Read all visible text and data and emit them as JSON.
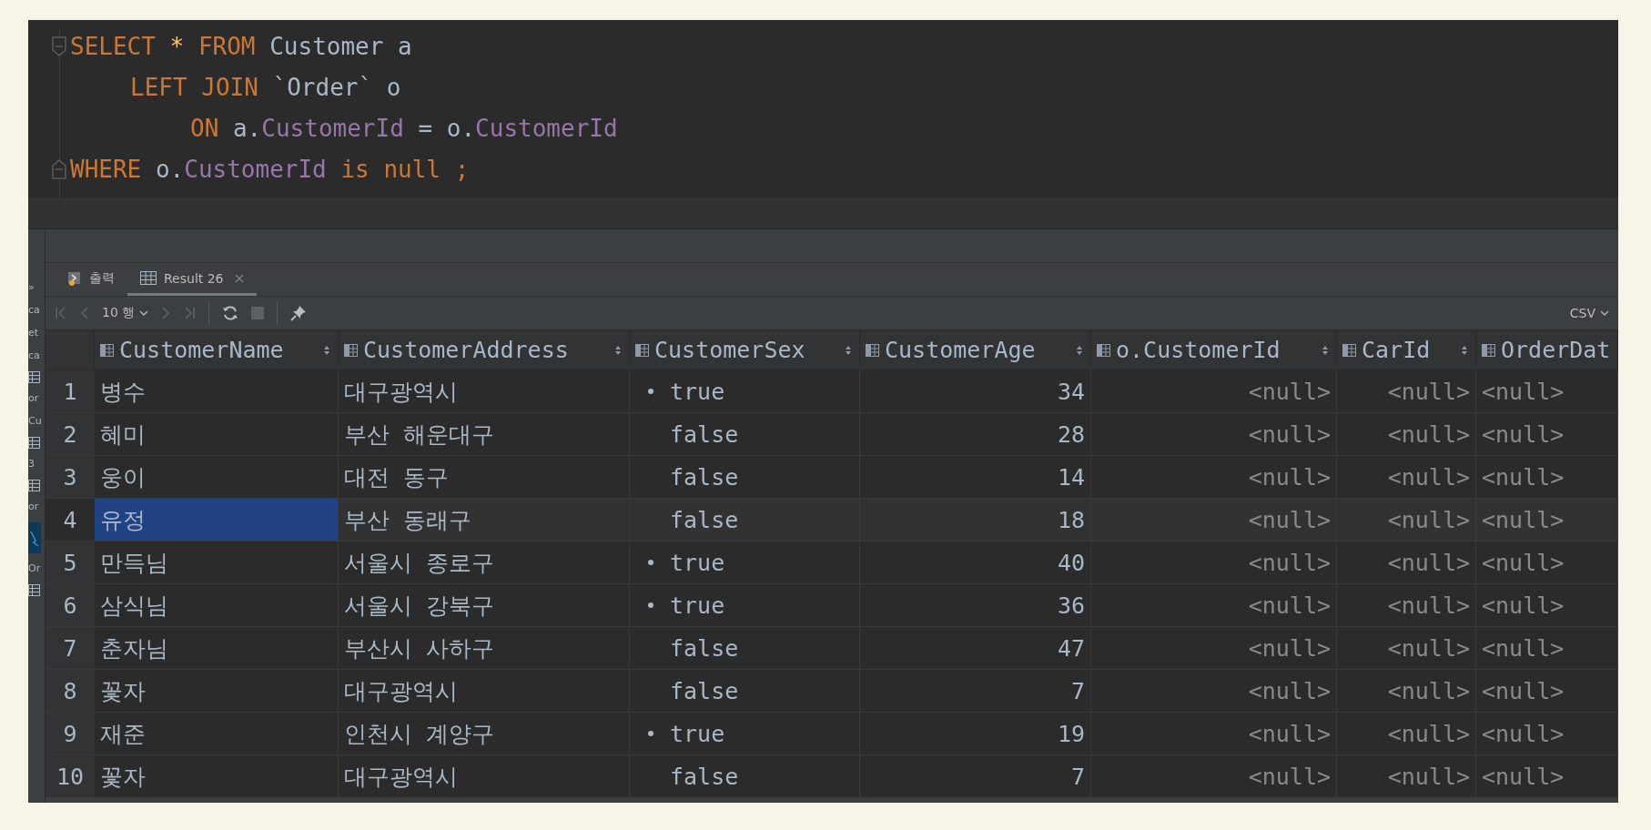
{
  "editor": {
    "lines": [
      {
        "kind": "top",
        "fold_open": true,
        "fold_close": false,
        "tokens": [
          {
            "kind": "keyword",
            "text": "SELECT"
          },
          {
            "kind": "star",
            "text": "*"
          },
          {
            "kind": "keyword",
            "text": "FROM"
          },
          {
            "kind": "plain",
            "text": "Customer a"
          }
        ]
      },
      {
        "kind": "sub",
        "fold_open": false,
        "fold_close": false,
        "tokens": [
          {
            "kind": "keyword",
            "text": "LEFT JOIN"
          },
          {
            "kind": "plain",
            "text": "`Order` o"
          }
        ]
      },
      {
        "kind": "subsub",
        "fold_open": false,
        "fold_close": false,
        "tokens": [
          {
            "kind": "keyword",
            "text": "ON"
          },
          {
            "kind": "plain",
            "text": "a."
          },
          {
            "kind": "field",
            "text": "CustomerId"
          },
          {
            "kind": "plain",
            "text": "="
          },
          {
            "kind": "plain",
            "text": "o."
          },
          {
            "kind": "field",
            "text": "CustomerId"
          }
        ]
      },
      {
        "kind": "top",
        "fold_open": false,
        "fold_close": true,
        "tokens": [
          {
            "kind": "keyword",
            "text": "WHERE"
          },
          {
            "kind": "plain",
            "text": "o."
          },
          {
            "kind": "field",
            "text": "CustomerId"
          },
          {
            "kind": "keyword",
            "text": "is null ;"
          }
        ]
      }
    ]
  },
  "side_strip": [
    {
      "kind": "text",
      "text": "»"
    },
    {
      "kind": "text",
      "text": "ca"
    },
    {
      "kind": "text",
      "text": "et"
    },
    {
      "kind": "text",
      "text": "ca"
    },
    {
      "kind": "icon"
    },
    {
      "kind": "text",
      "text": "or"
    },
    {
      "kind": "text",
      "text": "Cu"
    },
    {
      "kind": "icon"
    },
    {
      "kind": "text",
      "text": "3"
    },
    {
      "kind": "icon"
    },
    {
      "kind": "text",
      "text": "or"
    },
    {
      "kind": "selected"
    },
    {
      "kind": "text",
      "text": "Or"
    },
    {
      "kind": "icon"
    }
  ],
  "tabs": [
    {
      "kind": "output",
      "label": "출력",
      "selected": false
    },
    {
      "kind": "result",
      "label": "Result 26",
      "selected": true
    }
  ],
  "toolbar": {
    "page_size": "10 행",
    "export": "CSV"
  },
  "table": {
    "columns": [
      {
        "label": "CustomerName",
        "right_aligned": false,
        "kind": "text"
      },
      {
        "label": "CustomerAddress",
        "right_aligned": false,
        "kind": "text"
      },
      {
        "label": "CustomerSex",
        "right_aligned": false,
        "kind": "bool"
      },
      {
        "label": "CustomerAge",
        "right_aligned": true,
        "kind": "text"
      },
      {
        "label": "o.CustomerId",
        "right_aligned": true,
        "kind": "null"
      },
      {
        "label": "CarId",
        "right_aligned": true,
        "kind": "null"
      },
      {
        "label": "OrderDat",
        "right_aligned": false,
        "kind": "null"
      }
    ],
    "rows": [
      {
        "number": "1",
        "selected": false,
        "cells": [
          "병수",
          "대구광역시",
          "true",
          "34",
          "<null>",
          "<null>",
          "<null>"
        ],
        "flag": true
      },
      {
        "number": "2",
        "selected": false,
        "cells": [
          "혜미",
          "부산 해운대구",
          "false",
          "28",
          "<null>",
          "<null>",
          "<null>"
        ],
        "flag": false
      },
      {
        "number": "3",
        "selected": false,
        "cells": [
          "웅이",
          "대전 동구",
          "false",
          "14",
          "<null>",
          "<null>",
          "<null>"
        ],
        "flag": false
      },
      {
        "number": "4",
        "selected": true,
        "cells": [
          "유정",
          "부산 동래구",
          "false",
          "18",
          "<null>",
          "<null>",
          "<null>"
        ],
        "flag": false
      },
      {
        "number": "5",
        "selected": false,
        "cells": [
          "만득님",
          "서울시 종로구",
          "true",
          "40",
          "<null>",
          "<null>",
          "<null>"
        ],
        "flag": true
      },
      {
        "number": "6",
        "selected": false,
        "cells": [
          "삼식님",
          "서울시 강북구",
          "true",
          "36",
          "<null>",
          "<null>",
          "<null>"
        ],
        "flag": true
      },
      {
        "number": "7",
        "selected": false,
        "cells": [
          "춘자님",
          "부산시 사하구",
          "false",
          "47",
          "<null>",
          "<null>",
          "<null>"
        ],
        "flag": false
      },
      {
        "number": "8",
        "selected": false,
        "cells": [
          "꽃자",
          "대구광역시",
          "false",
          "7",
          "<null>",
          "<null>",
          "<null>"
        ],
        "flag": false
      },
      {
        "number": "9",
        "selected": false,
        "cells": [
          "재준",
          "인천시 계양구",
          "true",
          "19",
          "<null>",
          "<null>",
          "<null>"
        ],
        "flag": true
      },
      {
        "number": "10",
        "selected": false,
        "cells": [
          "꽃자",
          "대구광역시",
          "false",
          "7",
          "<null>",
          "<null>",
          "<null>"
        ],
        "flag": false
      }
    ]
  }
}
